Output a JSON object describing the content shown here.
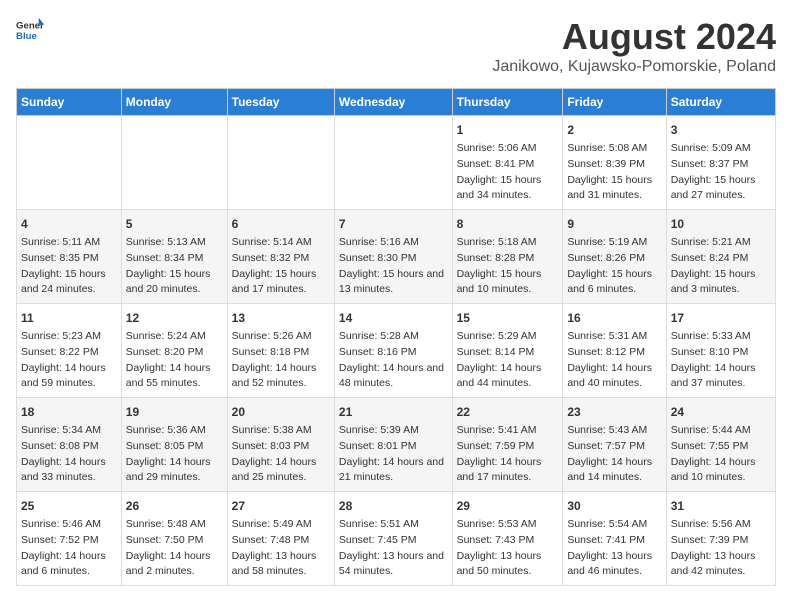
{
  "header": {
    "logo_general": "General",
    "logo_blue": "Blue",
    "main_title": "August 2024",
    "subtitle": "Janikowo, Kujawsko-Pomorskie, Poland"
  },
  "days_of_week": [
    "Sunday",
    "Monday",
    "Tuesday",
    "Wednesday",
    "Thursday",
    "Friday",
    "Saturday"
  ],
  "weeks": [
    [
      {
        "day": "",
        "info": ""
      },
      {
        "day": "",
        "info": ""
      },
      {
        "day": "",
        "info": ""
      },
      {
        "day": "",
        "info": ""
      },
      {
        "day": "1",
        "info": "Sunrise: 5:06 AM\nSunset: 8:41 PM\nDaylight: 15 hours and 34 minutes."
      },
      {
        "day": "2",
        "info": "Sunrise: 5:08 AM\nSunset: 8:39 PM\nDaylight: 15 hours and 31 minutes."
      },
      {
        "day": "3",
        "info": "Sunrise: 5:09 AM\nSunset: 8:37 PM\nDaylight: 15 hours and 27 minutes."
      }
    ],
    [
      {
        "day": "4",
        "info": "Sunrise: 5:11 AM\nSunset: 8:35 PM\nDaylight: 15 hours and 24 minutes."
      },
      {
        "day": "5",
        "info": "Sunrise: 5:13 AM\nSunset: 8:34 PM\nDaylight: 15 hours and 20 minutes."
      },
      {
        "day": "6",
        "info": "Sunrise: 5:14 AM\nSunset: 8:32 PM\nDaylight: 15 hours and 17 minutes."
      },
      {
        "day": "7",
        "info": "Sunrise: 5:16 AM\nSunset: 8:30 PM\nDaylight: 15 hours and 13 minutes."
      },
      {
        "day": "8",
        "info": "Sunrise: 5:18 AM\nSunset: 8:28 PM\nDaylight: 15 hours and 10 minutes."
      },
      {
        "day": "9",
        "info": "Sunrise: 5:19 AM\nSunset: 8:26 PM\nDaylight: 15 hours and 6 minutes."
      },
      {
        "day": "10",
        "info": "Sunrise: 5:21 AM\nSunset: 8:24 PM\nDaylight: 15 hours and 3 minutes."
      }
    ],
    [
      {
        "day": "11",
        "info": "Sunrise: 5:23 AM\nSunset: 8:22 PM\nDaylight: 14 hours and 59 minutes."
      },
      {
        "day": "12",
        "info": "Sunrise: 5:24 AM\nSunset: 8:20 PM\nDaylight: 14 hours and 55 minutes."
      },
      {
        "day": "13",
        "info": "Sunrise: 5:26 AM\nSunset: 8:18 PM\nDaylight: 14 hours and 52 minutes."
      },
      {
        "day": "14",
        "info": "Sunrise: 5:28 AM\nSunset: 8:16 PM\nDaylight: 14 hours and 48 minutes."
      },
      {
        "day": "15",
        "info": "Sunrise: 5:29 AM\nSunset: 8:14 PM\nDaylight: 14 hours and 44 minutes."
      },
      {
        "day": "16",
        "info": "Sunrise: 5:31 AM\nSunset: 8:12 PM\nDaylight: 14 hours and 40 minutes."
      },
      {
        "day": "17",
        "info": "Sunrise: 5:33 AM\nSunset: 8:10 PM\nDaylight: 14 hours and 37 minutes."
      }
    ],
    [
      {
        "day": "18",
        "info": "Sunrise: 5:34 AM\nSunset: 8:08 PM\nDaylight: 14 hours and 33 minutes."
      },
      {
        "day": "19",
        "info": "Sunrise: 5:36 AM\nSunset: 8:05 PM\nDaylight: 14 hours and 29 minutes."
      },
      {
        "day": "20",
        "info": "Sunrise: 5:38 AM\nSunset: 8:03 PM\nDaylight: 14 hours and 25 minutes."
      },
      {
        "day": "21",
        "info": "Sunrise: 5:39 AM\nSunset: 8:01 PM\nDaylight: 14 hours and 21 minutes."
      },
      {
        "day": "22",
        "info": "Sunrise: 5:41 AM\nSunset: 7:59 PM\nDaylight: 14 hours and 17 minutes."
      },
      {
        "day": "23",
        "info": "Sunrise: 5:43 AM\nSunset: 7:57 PM\nDaylight: 14 hours and 14 minutes."
      },
      {
        "day": "24",
        "info": "Sunrise: 5:44 AM\nSunset: 7:55 PM\nDaylight: 14 hours and 10 minutes."
      }
    ],
    [
      {
        "day": "25",
        "info": "Sunrise: 5:46 AM\nSunset: 7:52 PM\nDaylight: 14 hours and 6 minutes."
      },
      {
        "day": "26",
        "info": "Sunrise: 5:48 AM\nSunset: 7:50 PM\nDaylight: 14 hours and 2 minutes."
      },
      {
        "day": "27",
        "info": "Sunrise: 5:49 AM\nSunset: 7:48 PM\nDaylight: 13 hours and 58 minutes."
      },
      {
        "day": "28",
        "info": "Sunrise: 5:51 AM\nSunset: 7:45 PM\nDaylight: 13 hours and 54 minutes."
      },
      {
        "day": "29",
        "info": "Sunrise: 5:53 AM\nSunset: 7:43 PM\nDaylight: 13 hours and 50 minutes."
      },
      {
        "day": "30",
        "info": "Sunrise: 5:54 AM\nSunset: 7:41 PM\nDaylight: 13 hours and 46 minutes."
      },
      {
        "day": "31",
        "info": "Sunrise: 5:56 AM\nSunset: 7:39 PM\nDaylight: 13 hours and 42 minutes."
      }
    ]
  ]
}
